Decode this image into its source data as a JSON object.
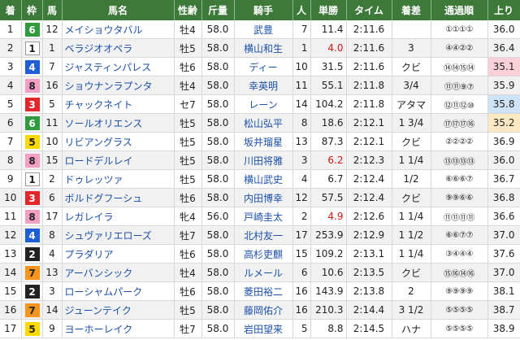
{
  "header": {
    "finish": "着",
    "frame": "枠",
    "number": "馬",
    "horse": "馬名",
    "sex_age": "性齢",
    "weight": "斤量",
    "jockey": "騎手",
    "popularity": "人",
    "odds": "単勝",
    "time": "タイム",
    "margin": "着差",
    "passing": "通過順",
    "last3f": "上り"
  },
  "frame_colors": {
    "1": {
      "bg": "#ffffff",
      "fg": "#222222",
      "border": "#999999"
    },
    "2": {
      "bg": "#222222",
      "fg": "#ffffff",
      "border": "#222222"
    },
    "3": {
      "bg": "#e3262b",
      "fg": "#ffffff",
      "border": "#e3262b"
    },
    "4": {
      "bg": "#1f5fd6",
      "fg": "#ffffff",
      "border": "#1f5fd6"
    },
    "5": {
      "bg": "#ffd800",
      "fg": "#222222",
      "border": "#ffd800"
    },
    "6": {
      "bg": "#2e9c3c",
      "fg": "#ffffff",
      "border": "#2e9c3c"
    },
    "7": {
      "bg": "#f7941d",
      "fg": "#222222",
      "border": "#f7941d"
    },
    "8": {
      "bg": "#f39ec3",
      "fg": "#222222",
      "border": "#f39ec3"
    }
  },
  "highlight_colors": {
    "odds_favorite": "#d01818",
    "last3f_best": "#fbd1d9",
    "last3f_second": "#fde8c4",
    "last3f_third": "#cfe3f7"
  },
  "rows": [
    {
      "finish": "1",
      "frame": "6",
      "number": "12",
      "horse": "メイショウタバル",
      "sex_age": "牡4",
      "weight": "58.0",
      "jockey": "武豊",
      "popularity": "7",
      "odds": "11.4",
      "time": "2:11.6",
      "margin": "",
      "passing": "①①①①",
      "last3f": "36.0"
    },
    {
      "finish": "2",
      "frame": "1",
      "number": "1",
      "horse": "ベラジオオペラ",
      "sex_age": "牡5",
      "weight": "58.0",
      "jockey": "横山和生",
      "popularity": "1",
      "odds": "4.0",
      "time": "2:11.6",
      "margin": "3",
      "passing": "④④②②",
      "last3f": "36.4"
    },
    {
      "finish": "3",
      "frame": "4",
      "number": "7",
      "horse": "ジャスティンパレス",
      "sex_age": "牡6",
      "weight": "58.0",
      "jockey": "ディー",
      "popularity": "10",
      "odds": "31.5",
      "time": "2:11.6",
      "margin": "クビ",
      "passing": "⑭⑭⑮⑭",
      "last3f": "35.1"
    },
    {
      "finish": "4",
      "frame": "8",
      "number": "16",
      "horse": "ショウナンラプンタ",
      "sex_age": "牡4",
      "weight": "58.0",
      "jockey": "幸英明",
      "popularity": "11",
      "odds": "55.1",
      "time": "2:11.8",
      "margin": "3/4",
      "passing": "⑪⑪⑨⑦",
      "last3f": "35.9"
    },
    {
      "finish": "5",
      "frame": "3",
      "number": "5",
      "horse": "チャックネイト",
      "sex_age": "セ7",
      "weight": "58.0",
      "jockey": "レーン",
      "popularity": "14",
      "odds": "104.2",
      "time": "2:11.8",
      "margin": "アタマ",
      "passing": "⑫⑪⑫⑩",
      "last3f": "35.8"
    },
    {
      "finish": "6",
      "frame": "6",
      "number": "11",
      "horse": "ソールオリエンス",
      "sex_age": "牡5",
      "weight": "58.0",
      "jockey": "松山弘平",
      "popularity": "8",
      "odds": "18.6",
      "time": "2:12.1",
      "margin": "1 3/4",
      "passing": "⑰⑰⑰⑯",
      "last3f": "35.2"
    },
    {
      "finish": "7",
      "frame": "5",
      "number": "10",
      "horse": "リビアングラス",
      "sex_age": "牡5",
      "weight": "58.0",
      "jockey": "坂井瑠星",
      "popularity": "13",
      "odds": "87.3",
      "time": "2:12.1",
      "margin": "クビ",
      "passing": "②②②②",
      "last3f": "36.9"
    },
    {
      "finish": "8",
      "frame": "8",
      "number": "15",
      "horse": "ロードデルレイ",
      "sex_age": "牡5",
      "weight": "58.0",
      "jockey": "川田将雅",
      "popularity": "3",
      "odds": "6.2",
      "time": "2:12.3",
      "margin": "1 1/4",
      "passing": "⑬⑬⑬⑬",
      "last3f": "36.0"
    },
    {
      "finish": "9",
      "frame": "1",
      "number": "2",
      "horse": "ドゥレッツァ",
      "sex_age": "牡5",
      "weight": "58.0",
      "jockey": "横山武史",
      "popularity": "4",
      "odds": "6.7",
      "time": "2:12.4",
      "margin": "1/2",
      "passing": "⑥⑥⑥⑦",
      "last3f": "36.7"
    },
    {
      "finish": "10",
      "frame": "3",
      "number": "6",
      "horse": "ボルドグフーシュ",
      "sex_age": "牡6",
      "weight": "58.0",
      "jockey": "内田博幸",
      "popularity": "12",
      "odds": "57.5",
      "time": "2:12.4",
      "margin": "クビ",
      "passing": "⑨⑨⑥⑥",
      "last3f": "36.8"
    },
    {
      "finish": "11",
      "frame": "8",
      "number": "17",
      "horse": "レガレイラ",
      "sex_age": "牝4",
      "weight": "56.0",
      "jockey": "戸崎圭太",
      "popularity": "2",
      "odds": "4.9",
      "time": "2:12.6",
      "margin": "1 1/4",
      "passing": "⑪⑪⑪⑪",
      "last3f": "36.6"
    },
    {
      "finish": "12",
      "frame": "4",
      "number": "8",
      "horse": "シュヴァリエローズ",
      "sex_age": "牡7",
      "weight": "58.0",
      "jockey": "北村友一",
      "popularity": "17",
      "odds": "253.9",
      "time": "2:12.9",
      "margin": "1 1/2",
      "passing": "⑥⑥⑦⑦",
      "last3f": "37.0"
    },
    {
      "finish": "13",
      "frame": "2",
      "number": "4",
      "horse": "プラダリア",
      "sex_age": "牡6",
      "weight": "58.0",
      "jockey": "高杉吏麒",
      "popularity": "15",
      "odds": "109.2",
      "time": "2:13.1",
      "margin": "1 1/4",
      "passing": "③④④④",
      "last3f": "37.6"
    },
    {
      "finish": "14",
      "frame": "7",
      "number": "13",
      "horse": "アーバンシック",
      "sex_age": "牡4",
      "weight": "58.0",
      "jockey": "ルメール",
      "popularity": "6",
      "odds": "10.6",
      "time": "2:13.5",
      "margin": "クビ",
      "passing": "⑮⑯⑭⑯",
      "last3f": "37.0"
    },
    {
      "finish": "15",
      "frame": "2",
      "number": "3",
      "horse": "ローシャムパーク",
      "sex_age": "牡6",
      "weight": "58.0",
      "jockey": "菱田裕二",
      "popularity": "16",
      "odds": "143.9",
      "time": "2:13.8",
      "margin": "2",
      "passing": "⑨⑨⑨⑨",
      "last3f": "38.1"
    },
    {
      "finish": "16",
      "frame": "7",
      "number": "14",
      "horse": "ジューンテイク",
      "sex_age": "牡5",
      "weight": "58.0",
      "jockey": "藤岡佑介",
      "popularity": "16",
      "odds": "210.3",
      "time": "2:14.4",
      "margin": "3 1/2",
      "passing": "⑤⑤⑤⑤",
      "last3f": "38.7"
    },
    {
      "finish": "17",
      "frame": "5",
      "number": "9",
      "horse": "ヨーホーレイク",
      "sex_age": "牡7",
      "weight": "58.0",
      "jockey": "岩田望来",
      "popularity": "5",
      "odds": "8.8",
      "time": "2:14.5",
      "margin": "ハナ",
      "passing": "⑤⑤⑤⑤",
      "last3f": "38.9"
    }
  ]
}
